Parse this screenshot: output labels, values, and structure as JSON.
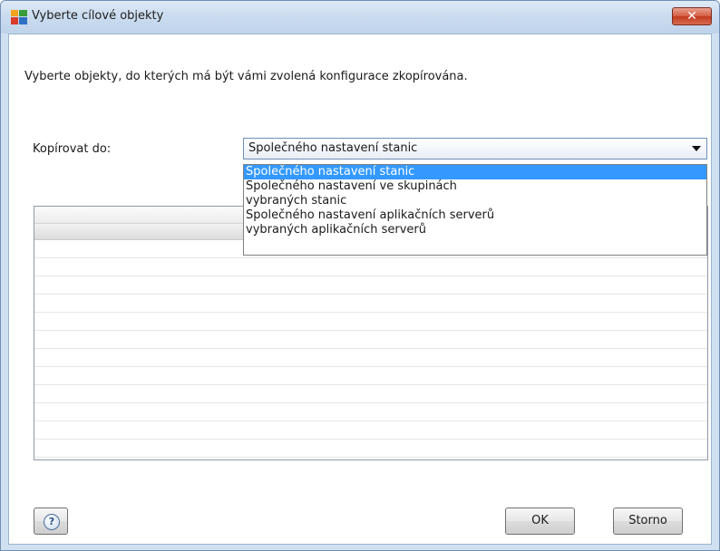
{
  "window": {
    "title": "Vyberte cílové objekty",
    "close_icon": "close-icon (×)"
  },
  "instruction": "Vyberte objekty, do kterých má být vámi zvolená konfigurace zkopírována.",
  "copy_to": {
    "label": "Kopírovat do:",
    "selected": "Společného nastavení stanic",
    "options": [
      "Společného nastavení stanic",
      "Společného nastavení ve skupinách",
      "vybraných stanic",
      "Společného nastavení aplikačních serverů",
      "vybraných aplikačních serverů"
    ]
  },
  "buttons": {
    "help_icon": "help-icon (?)",
    "help_symbol": "?",
    "ok": "OK",
    "cancel": "Storno"
  },
  "colors": {
    "selection": "#3399ff",
    "close_button": "#c13a1f",
    "titlebar": "#cbdcef"
  }
}
